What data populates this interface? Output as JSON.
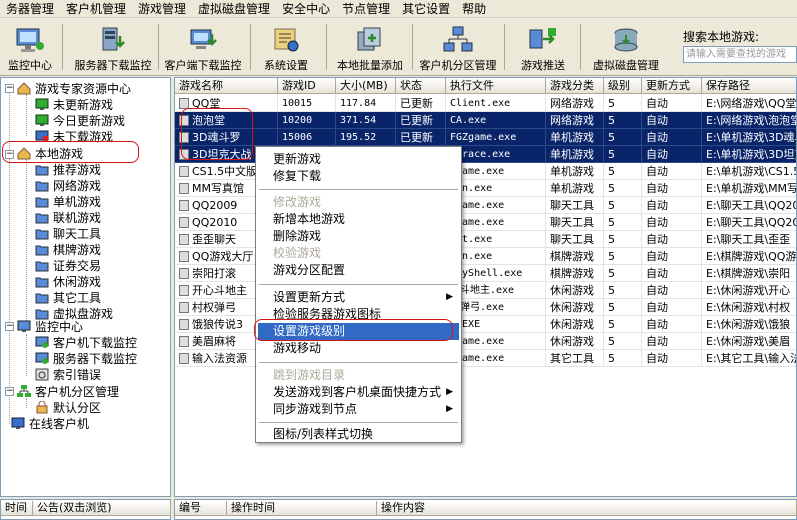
{
  "menubar": [
    "务器管理",
    "客户机管理",
    "游戏管理",
    "虚拟磁盘管理",
    "安全中心",
    "节点管理",
    "其它设置",
    "帮助"
  ],
  "toolbar": {
    "buttons": [
      "监控中心",
      "服务器下载监控",
      "客户端下载监控",
      "系统设置",
      "本地批量添加",
      "客户机分区管理",
      "游戏推送",
      "虚拟磁盘管理"
    ],
    "search_label": "搜索本地游戏:",
    "search_placeholder": "请输入需要查找的游戏"
  },
  "tree": {
    "root1": "游戏专家资源中心",
    "r1_children": [
      "未更新游戏",
      "今日更新游戏",
      "未下载游戏"
    ],
    "root2": "本地游戏",
    "r2_children": [
      "推荐游戏",
      "网络游戏",
      "单机游戏",
      "联机游戏",
      "聊天工具",
      "棋牌游戏",
      "证券交易",
      "休闲游戏",
      "其它工具",
      "虚拟盘游戏"
    ],
    "root3": "监控中心",
    "r3_children": [
      "客户机下载监控",
      "服务器下载监控",
      "索引错误"
    ],
    "root4": "客户机分区管理",
    "r4_children": [
      "默认分区"
    ],
    "root5": "在线客户机"
  },
  "grid": {
    "columns": [
      "游戏名称",
      "游戏ID",
      "大小(MB)",
      "状态",
      "执行文件",
      "游戏分类",
      "级别",
      "更新方式",
      "保存路径"
    ],
    "rows": [
      [
        "QQ堂",
        "10015",
        "117.84",
        "已更新",
        "Client.exe",
        "网络游戏",
        "5",
        "自动",
        "E:\\网络游戏\\QQ堂"
      ],
      [
        "泡泡堂",
        "10200",
        "371.54",
        "已更新",
        "CA.exe",
        "网络游戏",
        "5",
        "自动",
        "E:\\网络游戏\\泡泡堂"
      ],
      [
        "3D魂斗罗",
        "15006",
        "195.52",
        "已更新",
        "FGZgame.exe",
        "单机游戏",
        "5",
        "自动",
        "E:\\单机游戏\\3D魂斗罗"
      ],
      [
        "3D坦克大战",
        "",
        "",
        "",
        "akrace.exe",
        "单机游戏",
        "5",
        "自动",
        "E:\\单机游戏\\3D坦克大战"
      ],
      [
        "CS1.5中文版",
        "",
        "",
        "",
        "Zgame.exe",
        "单机游戏",
        "5",
        "自动",
        "E:\\单机游戏\\CS1.5"
      ],
      [
        "MM写真馆",
        "",
        "",
        "",
        "Mon.exe",
        "单机游戏",
        "5",
        "自动",
        "E:\\单机游戏\\MM写真"
      ],
      [
        "QQ2009",
        "",
        "",
        "",
        "Zgame.exe",
        "聊天工具",
        "5",
        "自动",
        "E:\\聊天工具\\QQ2009"
      ],
      [
        "QQ2010",
        "",
        "",
        "",
        "Zgame.exe",
        "聊天工具",
        "5",
        "自动",
        "E:\\聊天工具\\QQ2010"
      ],
      [
        "歪歪聊天",
        "",
        "",
        "",
        "art.exe",
        "聊天工具",
        "5",
        "自动",
        "E:\\聊天工具\\歪歪"
      ],
      [
        "QQ游戏大厅",
        "",
        "",
        "",
        "Mon.exe",
        "棋牌游戏",
        "5",
        "自动",
        "E:\\棋牌游戏\\QQ游戏"
      ],
      [
        "崇阳打滚",
        "",
        "",
        "",
        "bbyShell.exe",
        "棋牌游戏",
        "5",
        "自动",
        "E:\\棋牌游戏\\崇阳"
      ],
      [
        "开心斗地主",
        "",
        "",
        "",
        "心斗地主.exe",
        "休闲游戏",
        "5",
        "自动",
        "E:\\休闲游戏\\开心"
      ],
      [
        "村权弹弓",
        "",
        "",
        "",
        "权弹弓.exe",
        "休闲游戏",
        "5",
        "自动",
        "E:\\休闲游戏\\村权"
      ],
      [
        "饿狼传说3",
        "",
        "",
        "",
        "3.EXE",
        "休闲游戏",
        "5",
        "自动",
        "E:\\休闲游戏\\饿狼"
      ],
      [
        "美眉麻将",
        "",
        "",
        "",
        "Zgame.exe",
        "休闲游戏",
        "5",
        "自动",
        "E:\\休闲游戏\\美眉"
      ],
      [
        "输入法资源",
        "",
        "",
        "",
        "Zgame.exe",
        "其它工具",
        "5",
        "自动",
        "E:\\其它工具\\输入法"
      ]
    ]
  },
  "context_menu": {
    "items": [
      "更新游戏",
      "修复下载",
      "修改游戏",
      "新增本地游戏",
      "删除游戏",
      "校验游戏",
      "游戏分区配置",
      "设置更新方式",
      "检验服务器游戏图标",
      "设置游戏级别",
      "游戏移动",
      "跳到游戏目录",
      "发送游戏到客户机桌面快捷方式",
      "同步游戏到节点",
      "图标/列表样式切换"
    ]
  },
  "bottom": {
    "left_cols": [
      "时间",
      "公告(双击浏览)"
    ],
    "right_cols": [
      "编号",
      "操作时间",
      "操作内容"
    ]
  }
}
